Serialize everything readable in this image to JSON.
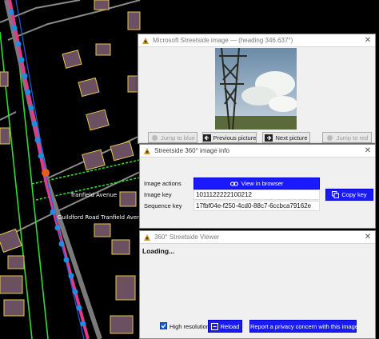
{
  "map": {
    "street_labels": [
      "Tranfield Avenue",
      "Guildford Road Tranfield Avenue"
    ]
  },
  "image_window": {
    "title": "Microsoft Streetside image — (heading 346.637°)",
    "buttons": {
      "jump_blue": "Jump to blue",
      "previous": "Previous picture",
      "next": "Next picture",
      "jump_red": "Jump to red"
    }
  },
  "info_window": {
    "title": "Streetside 360° image info",
    "image_actions_label": "Image actions",
    "view_in_browser": "View in browser",
    "image_key_label": "Image key",
    "image_key_value": "1011122222100212",
    "copy_key": "Copy key",
    "sequence_key_label": "Sequence key",
    "sequence_key_value": "17fbf04e-f250-4cd0-88c7-6ccbca79162e"
  },
  "viewer_window": {
    "title": "360° Streetside Viewer",
    "status": "Loading...",
    "high_resolution_label": "High resolution",
    "high_resolution_checked": true,
    "reload": "Reload",
    "report": "Report a privacy concern with this image"
  },
  "colors": {
    "accent_blue": "#1a1aff",
    "map_background": "#000000",
    "building_outline": "#e8c84a",
    "road_line": "#9a9a9a",
    "streetside_track": "#e03a8a",
    "track_dot": "#1e8fe0",
    "boundary_green": "#2fdc2f"
  },
  "icons": {
    "window_logo": "josm-logo-icon",
    "close": "close-icon",
    "previous": "arrow-left-icon",
    "next": "arrow-right-icon",
    "link": "link-icon",
    "copy": "copy-icon",
    "reload": "reload-icon",
    "report": "privacy-report-icon"
  }
}
